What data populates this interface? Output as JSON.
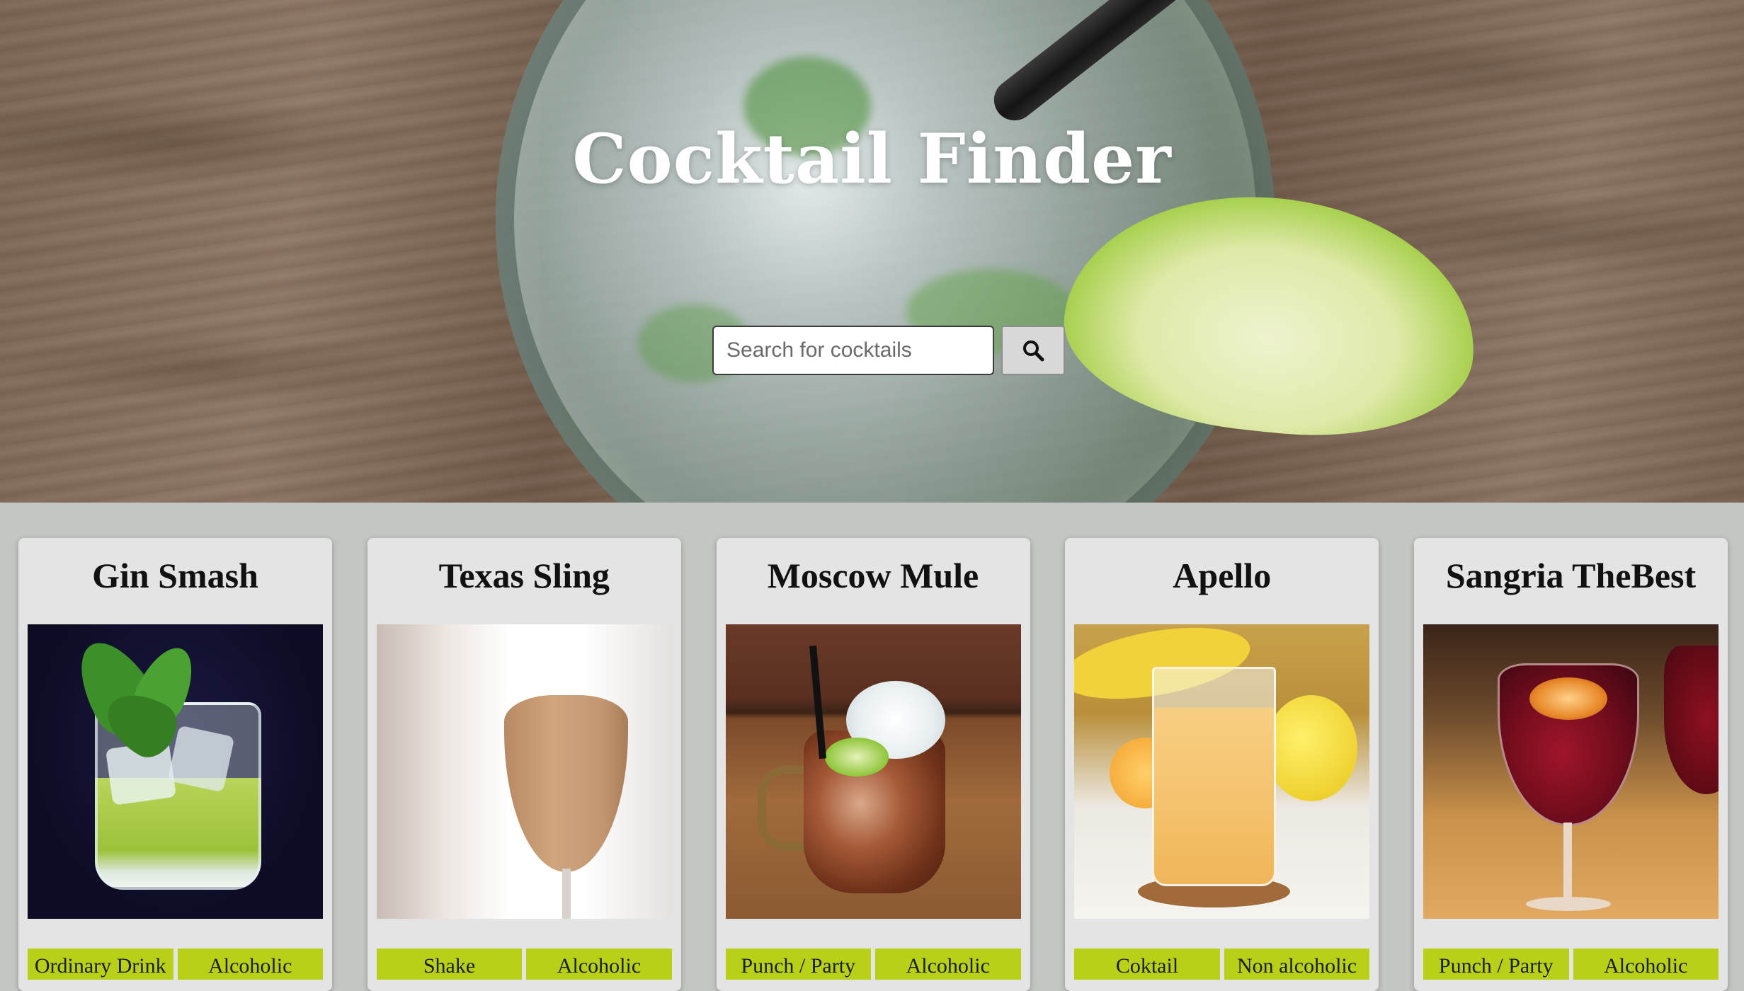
{
  "hero": {
    "title": "Cocktail Finder",
    "search": {
      "placeholder": "Search for cocktails",
      "value": "",
      "button_icon": "search-icon"
    }
  },
  "cards": [
    {
      "name": "Gin Smash",
      "tags": [
        "Ordinary Drink",
        "Alcoholic"
      ]
    },
    {
      "name": "Texas Sling",
      "tags": [
        "Shake",
        "Alcoholic"
      ]
    },
    {
      "name": "Moscow Mule",
      "tags": [
        "Punch / Party",
        "Alcoholic"
      ]
    },
    {
      "name": "Apello",
      "tags": [
        "Coktail",
        "Non alcoholic"
      ]
    },
    {
      "name": "Sangria TheBest",
      "tags": [
        "Punch / Party",
        "Alcoholic"
      ]
    }
  ],
  "colors": {
    "tag_background": "#b8d118",
    "card_background": "#e4e4e4",
    "page_background": "#c4c6c3"
  }
}
